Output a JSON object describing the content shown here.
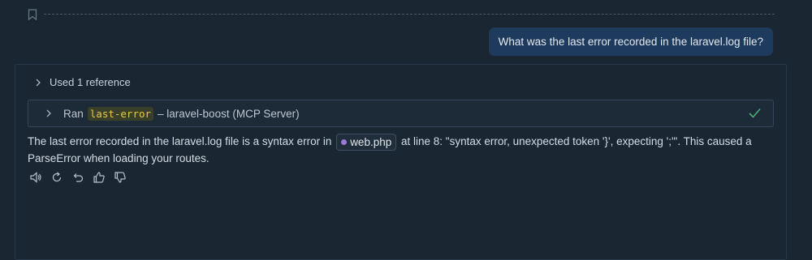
{
  "chat": {
    "user_message": "What was the last error recorded in the laravel.log file?",
    "references": {
      "label": "Used 1 reference"
    },
    "tool_call": {
      "ran_label": "Ran",
      "tool_name": "last-error",
      "source": "– laravel-boost (MCP Server)",
      "status": "success"
    },
    "answer": {
      "part1": "The last error recorded in the laravel.log file is a syntax error in",
      "file": "web.php",
      "part2": "at line 8: \"syntax error, unexpected token '}', expecting ';'\". This caused a ParseError when loading your routes."
    },
    "actions": [
      "speaker-icon",
      "retry-icon",
      "undo-icon",
      "thumbs-up-icon",
      "thumbs-down-icon"
    ]
  },
  "colors": {
    "background": "#1a2733",
    "user_bubble": "#1e3a5c",
    "tool_highlight": "#e6c84e",
    "success_check": "#4caf72",
    "php_icon": "#9a7ad6"
  }
}
